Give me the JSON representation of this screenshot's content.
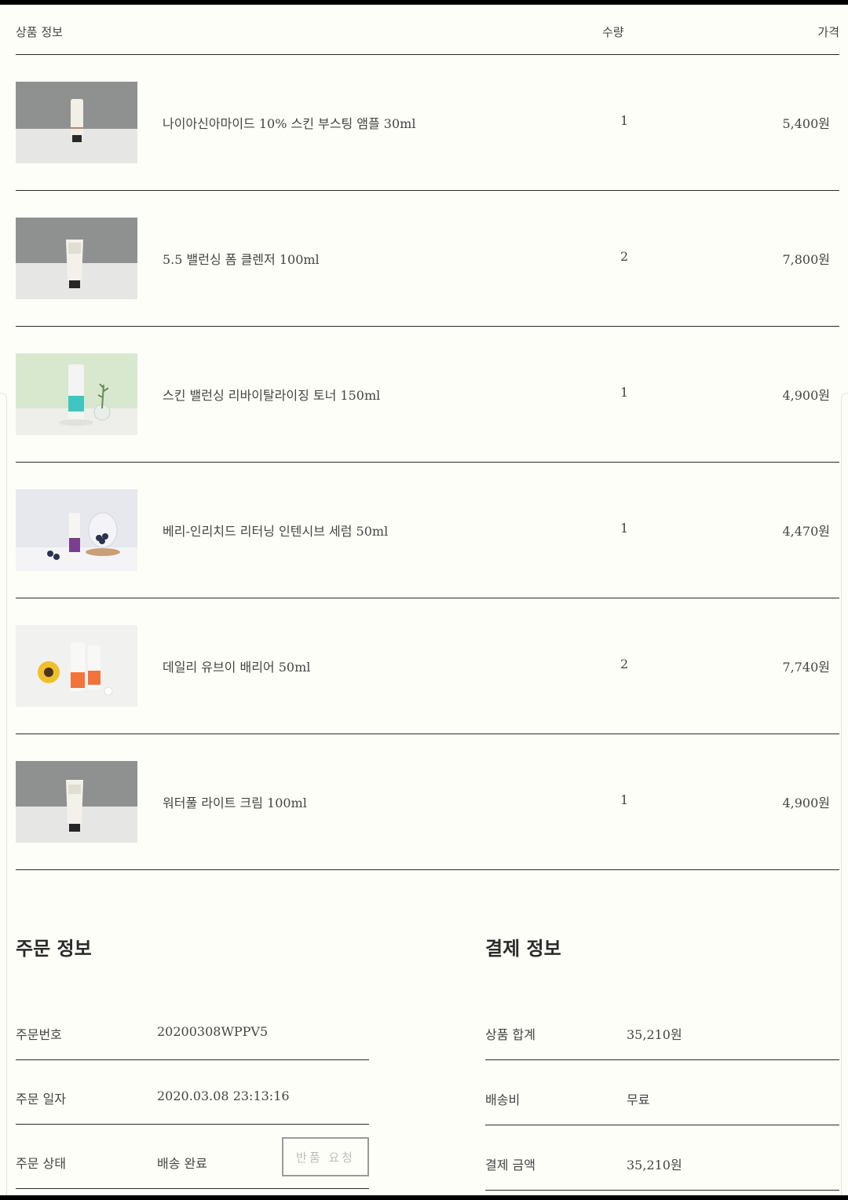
{
  "table_header": {
    "info": "상품 정보",
    "qty": "수량",
    "price": "가격"
  },
  "items": [
    {
      "name": "나이아신아마이드 10% 스킨 부스팅 앰플 30ml",
      "qty": "1",
      "price": "5,400원"
    },
    {
      "name": "5.5 밸런싱 폼 클렌저 100ml",
      "qty": "2",
      "price": "7,800원"
    },
    {
      "name": "스킨 밸런싱 리바이탈라이징 토너 150ml",
      "qty": "1",
      "price": "4,900원"
    },
    {
      "name": "베리-인리치드 리터닝 인텐시브 세럼 50ml",
      "qty": "1",
      "price": "4,470원"
    },
    {
      "name": "데일리 유브이 배리어 50ml",
      "qty": "2",
      "price": "7,740원"
    },
    {
      "name": "워터풀 라이트 크림 100ml",
      "qty": "1",
      "price": "4,900원"
    }
  ],
  "order_info": {
    "title": "주문 정보",
    "number_label": "주문번호",
    "number_value": "20200308WPPV5",
    "date_label": "주문 일자",
    "date_value": "2020.03.08 23:13:16",
    "status_label": "주문 상태",
    "status_value": "배송 완료",
    "return_button": "반품 요청"
  },
  "payment_info": {
    "title": "결제 정보",
    "subtotal_label": "상품 합계",
    "subtotal_value": "35,210원",
    "shipping_label": "배송비",
    "shipping_value": "무료",
    "total_label": "결제 금액",
    "total_value": "35,210원"
  }
}
